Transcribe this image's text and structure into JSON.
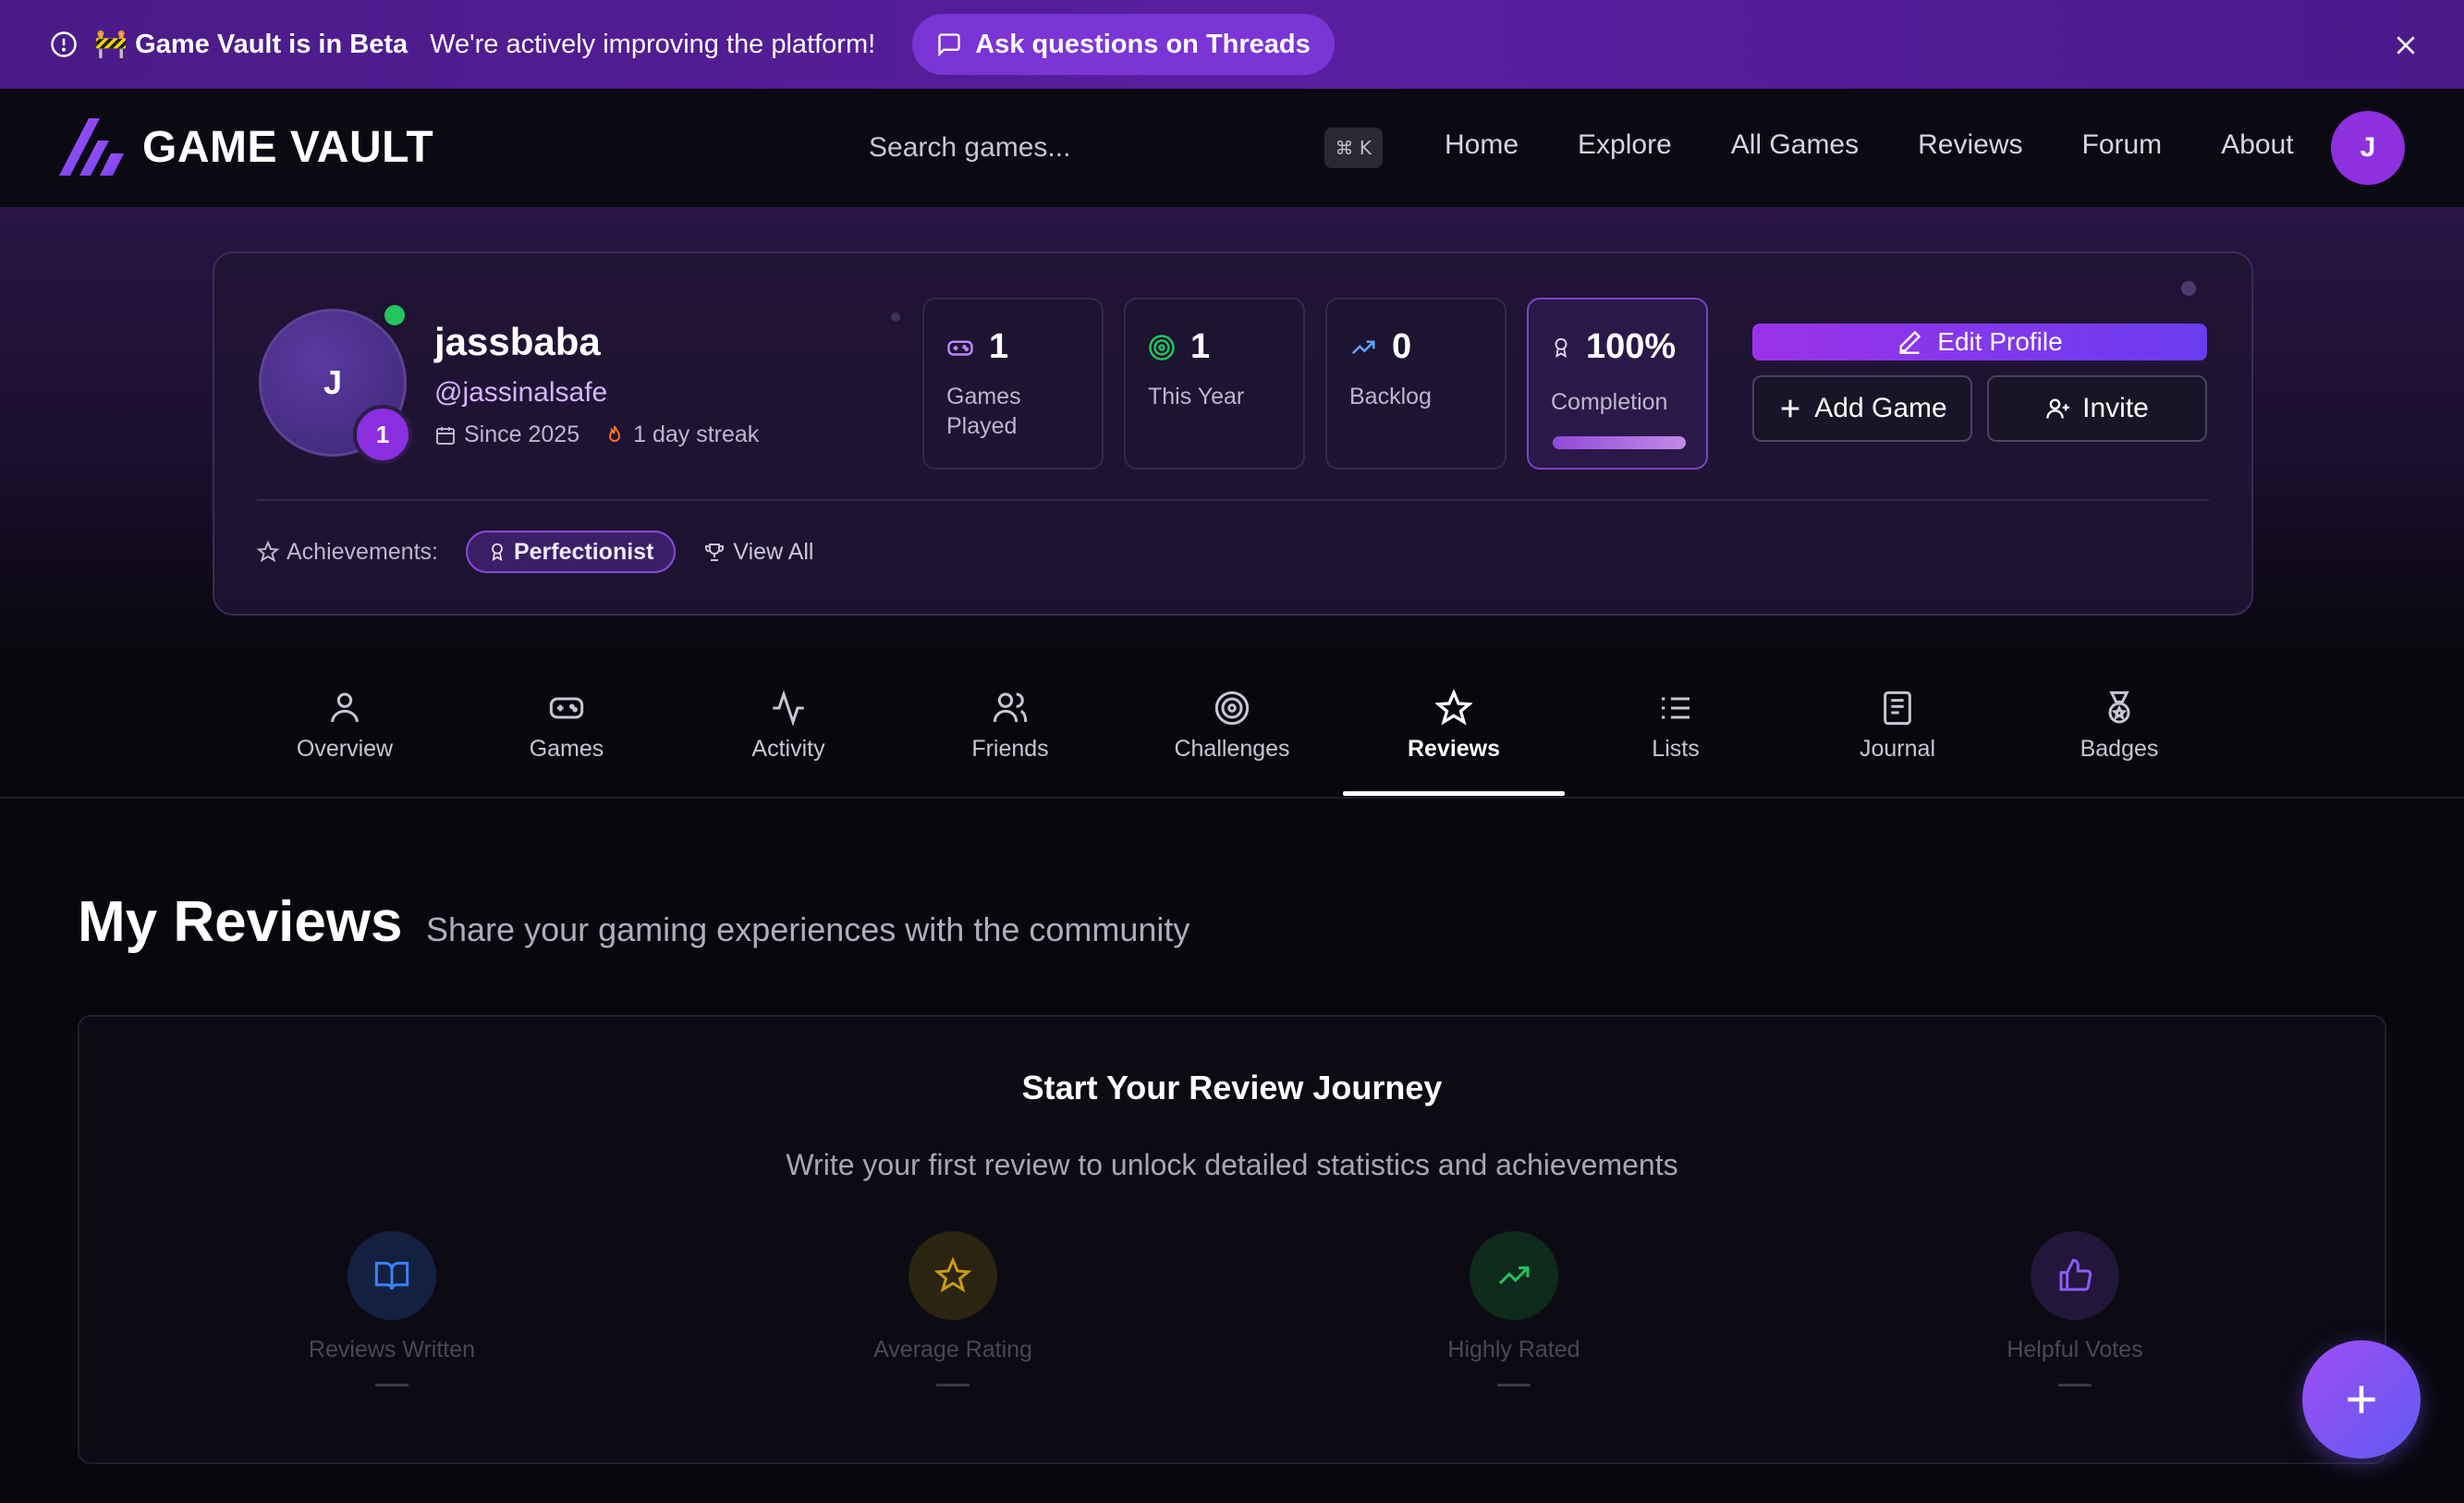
{
  "banner": {
    "title": "🚧 Game Vault is in Beta",
    "message": "We're actively improving the platform!",
    "threads_label": "Ask questions on Threads"
  },
  "nav": {
    "logo_text": "GAME VAULT",
    "search_placeholder": "Search games...",
    "shortcut": "⌘ K",
    "links": [
      "Home",
      "Explore",
      "All Games",
      "Reviews",
      "Forum",
      "About"
    ],
    "avatar_initial": "J"
  },
  "profile": {
    "avatar_initial": "J",
    "level": "1",
    "username": "jassbaba",
    "handle": "@jassinalsafe",
    "since": "Since 2025",
    "streak": "1 day streak",
    "stats": [
      {
        "value": "1",
        "label": "Games Played",
        "icon": "gamepad-icon"
      },
      {
        "value": "1",
        "label": "This Year",
        "icon": "target-icon"
      },
      {
        "value": "0",
        "label": "Backlog",
        "icon": "trending-up-icon"
      },
      {
        "value": "100%",
        "label": "Completion",
        "icon": "award-icon",
        "progress": 1.0
      }
    ],
    "edit_label": "Edit Profile",
    "add_game_label": "Add Game",
    "invite_label": "Invite",
    "achievements_label": "Achievements:",
    "achievement_badge": "Perfectionist",
    "view_all_label": "View All"
  },
  "tabs": [
    {
      "label": "Overview",
      "icon": "user-icon"
    },
    {
      "label": "Games",
      "icon": "gamepad-icon"
    },
    {
      "label": "Activity",
      "icon": "activity-icon"
    },
    {
      "label": "Friends",
      "icon": "users-icon"
    },
    {
      "label": "Challenges",
      "icon": "target-icon"
    },
    {
      "label": "Reviews",
      "icon": "star-icon",
      "active": true
    },
    {
      "label": "Lists",
      "icon": "list-icon"
    },
    {
      "label": "Journal",
      "icon": "notebook-icon"
    },
    {
      "label": "Badges",
      "icon": "medal-icon"
    }
  ],
  "section": {
    "title": "My Reviews",
    "subtitle": "Share your gaming experiences with the community"
  },
  "journey": {
    "title": "Start Your Review Journey",
    "text": "Write your first review to unlock detailed statistics and achievements",
    "stats": [
      {
        "label": "Reviews Written",
        "value": "—",
        "icon": "book-icon",
        "color": "#3b82f6"
      },
      {
        "label": "Average Rating",
        "value": "—",
        "icon": "star-icon",
        "color": "#eab308"
      },
      {
        "label": "Highly Rated",
        "value": "—",
        "icon": "trending-up-icon",
        "color": "#22c55e"
      },
      {
        "label": "Helpful Votes",
        "value": "—",
        "icon": "thumbs-up-icon",
        "color": "#a855f7"
      }
    ]
  },
  "colors": {
    "accent": "#8b2fe0",
    "banner": "#5a1ea1",
    "online": "#22c55e"
  }
}
